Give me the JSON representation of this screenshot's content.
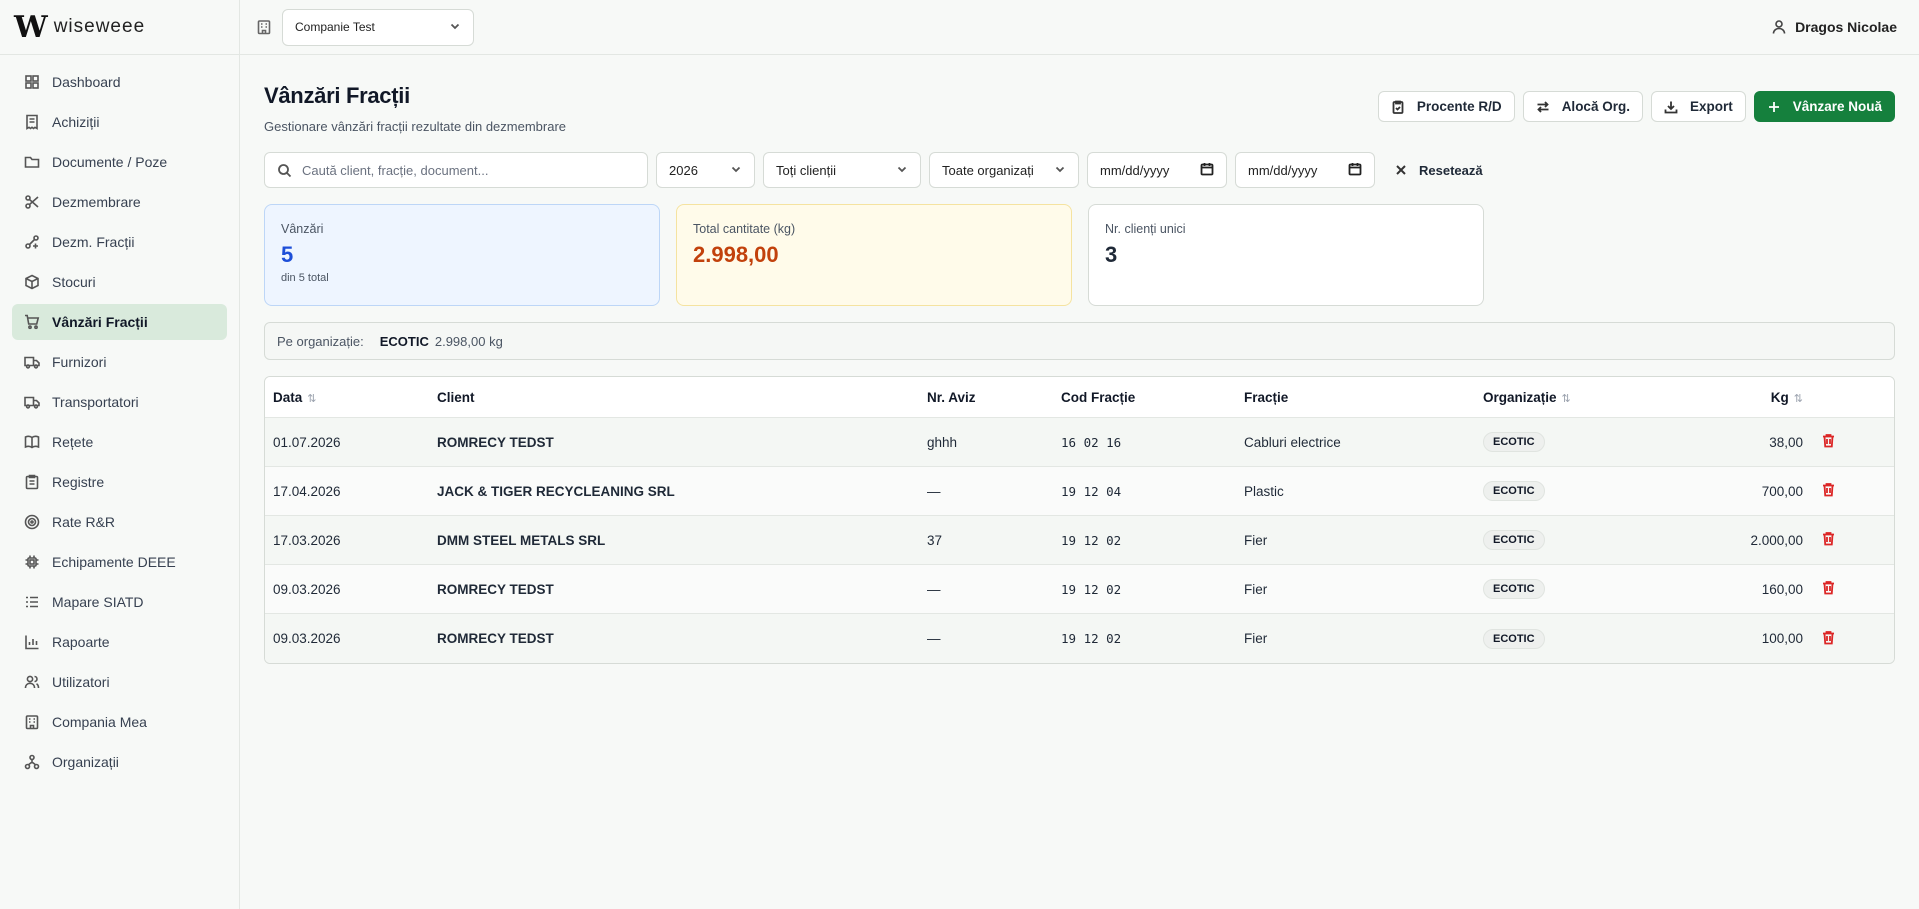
{
  "brand": {
    "mark": "W",
    "name": "wiseweee"
  },
  "sidebar": {
    "items": [
      {
        "label": "Dashboard",
        "icon": "grid-icon"
      },
      {
        "label": "Achiziții",
        "icon": "receipt-icon"
      },
      {
        "label": "Documente / Poze",
        "icon": "folder-icon"
      },
      {
        "label": "Dezmembrare",
        "icon": "scissors-icon"
      },
      {
        "label": "Dezm. Fracții",
        "icon": "split-icon"
      },
      {
        "label": "Stocuri",
        "icon": "box-icon"
      },
      {
        "label": "Vânzări Fracții",
        "icon": "cart-icon",
        "active": true
      },
      {
        "label": "Furnizori",
        "icon": "truck-icon"
      },
      {
        "label": "Transportatori",
        "icon": "truck-icon"
      },
      {
        "label": "Rețete",
        "icon": "book-icon"
      },
      {
        "label": "Registre",
        "icon": "clipboard-icon"
      },
      {
        "label": "Rate R&R",
        "icon": "target-icon"
      },
      {
        "label": "Echipamente DEEE",
        "icon": "cpu-icon"
      },
      {
        "label": "Mapare SIATD",
        "icon": "list-icon"
      },
      {
        "label": "Rapoarte",
        "icon": "chart-icon"
      },
      {
        "label": "Utilizatori",
        "icon": "users-icon"
      },
      {
        "label": "Compania Mea",
        "icon": "building-icon"
      },
      {
        "label": "Organizații",
        "icon": "network-icon"
      }
    ]
  },
  "topbar": {
    "company": "Companie Test",
    "user": "Dragos Nicolae"
  },
  "page": {
    "title": "Vânzări Fracții",
    "subtitle": "Gestionare vânzări fracții rezultate din dezmembrare"
  },
  "actions": {
    "procente": "Procente R/D",
    "aloca": "Alocă Org.",
    "export": "Export",
    "new": "Vânzare Nouă"
  },
  "filters": {
    "search_placeholder": "Caută client, fracție, document...",
    "year": "2026",
    "clients": "Toți clienții",
    "orgs": "Toate organizați",
    "date_from": "mm/dd/yyyy",
    "date_to": "mm/dd/yyyy",
    "reset": "Resetează"
  },
  "stats": {
    "sales": {
      "label": "Vânzări",
      "value": "5",
      "note": "din 5 total"
    },
    "qty": {
      "label": "Total cantitate (kg)",
      "value": "2.998,00"
    },
    "clients": {
      "label": "Nr. clienți unici",
      "value": "3"
    }
  },
  "org_summary": {
    "label": "Pe organizație:",
    "org": "ECOTIC",
    "value": "2.998,00 kg"
  },
  "table": {
    "headers": {
      "date": "Data",
      "client": "Client",
      "aviz": "Nr. Aviz",
      "cod": "Cod Fracție",
      "fractie": "Fracție",
      "org": "Organizație",
      "kg": "Kg"
    },
    "rows": [
      {
        "date": "01.07.2026",
        "client": "ROMRECY TEDST",
        "aviz": "ghhh",
        "cod": "16 02 16",
        "fractie": "Cabluri electrice",
        "org": "ECOTIC",
        "kg": "38,00"
      },
      {
        "date": "17.04.2026",
        "client": "JACK & TIGER RECYCLEANING SRL",
        "aviz": "—",
        "cod": "19 12 04",
        "fractie": "Plastic",
        "org": "ECOTIC",
        "kg": "700,00"
      },
      {
        "date": "17.03.2026",
        "client": "DMM STEEL METALS SRL",
        "aviz": "37",
        "cod": "19 12 02",
        "fractie": "Fier",
        "org": "ECOTIC",
        "kg": "2.000,00"
      },
      {
        "date": "09.03.2026",
        "client": "ROMRECY TEDST",
        "aviz": "—",
        "cod": "19 12 02",
        "fractie": "Fier",
        "org": "ECOTIC",
        "kg": "160,00"
      },
      {
        "date": "09.03.2026",
        "client": "ROMRECY TEDST",
        "aviz": "—",
        "cod": "19 12 02",
        "fractie": "Fier",
        "org": "ECOTIC",
        "kg": "100,00"
      }
    ]
  }
}
